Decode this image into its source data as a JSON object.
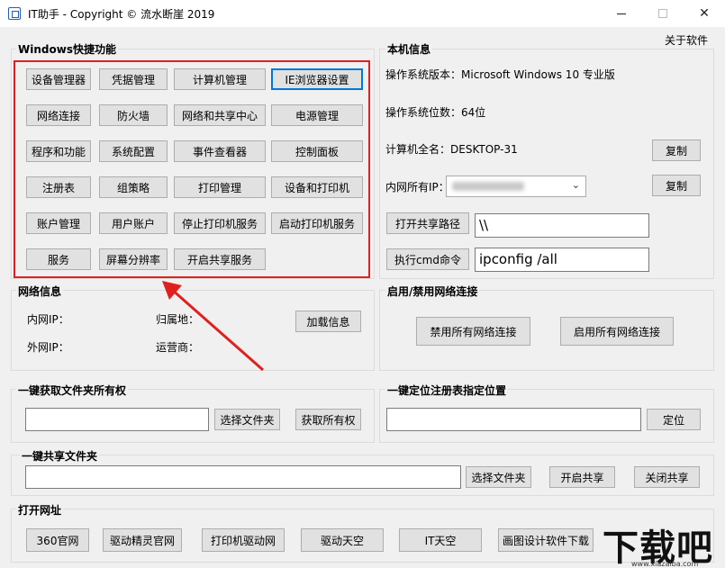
{
  "window": {
    "title": "IT助手 - Copyright © 流水断崖 2019",
    "about": "关于软件"
  },
  "windows_section": {
    "title": "Windows快捷功能",
    "buttons": [
      "设备管理器",
      "凭据管理",
      "计算机管理",
      "IE浏览器设置",
      "网络连接",
      "防火墙",
      "网络和共享中心",
      "电源管理",
      "程序和功能",
      "系统配置",
      "事件查看器",
      "控制面板",
      "注册表",
      "组策略",
      "打印管理",
      "设备和打印机",
      "账户管理",
      "用户账户",
      "停止打印机服务",
      "启动打印机服务",
      "服务",
      "屏幕分辨率",
      "开启共享服务"
    ]
  },
  "local_info": {
    "title": "本机信息",
    "os_version": "操作系统版本：Microsoft Windows 10 专业版",
    "os_bits": "操作系统位数：64位",
    "computer_name": "计算机全名：DESKTOP-31",
    "copy_label": "复制",
    "lan_ip_label": "内网所有IP：",
    "open_share_label": "打开共享路径",
    "share_path_value": "\\\\",
    "run_cmd_label": "执行cmd命令",
    "cmd_value": "ipconfig /all"
  },
  "network_info": {
    "title": "网络信息",
    "lan_ip": "内网IP：",
    "wan_ip": "外网IP：",
    "location": "归属地：",
    "isp": "运营商：",
    "load_label": "加载信息"
  },
  "net_toggle": {
    "title": "启用/禁用网络连接",
    "disable_label": "禁用所有网络连接",
    "enable_label": "启用所有网络连接"
  },
  "ownership": {
    "title": "一键获取文件夹所有权",
    "path_value": "",
    "choose_label": "选择文件夹",
    "take_label": "获取所有权"
  },
  "registry": {
    "title": "一键定位注册表指定位置",
    "path_value": "",
    "locate_label": "定位"
  },
  "share_folder": {
    "title": "一键共享文件夹",
    "path_value": "",
    "choose_label": "选择文件夹",
    "start_label": "开启共享",
    "stop_label": "关闭共享"
  },
  "urls": {
    "title": "打开网址",
    "links": [
      "360官网",
      "驱动精灵官网",
      "打印机驱动网",
      "驱动天空",
      "IT天空",
      "画图设计软件下载"
    ]
  },
  "watermark": {
    "text": "下载吧",
    "site": "www.xiazaiba.com"
  },
  "colors": {
    "annotation_red": "#e02020",
    "focus_blue": "#0078d7"
  }
}
